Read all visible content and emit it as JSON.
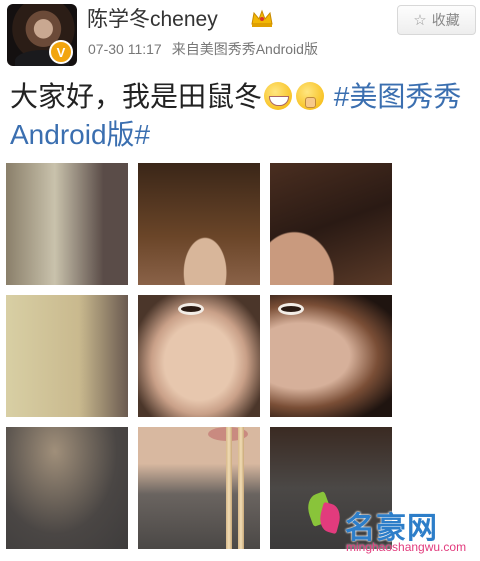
{
  "user": {
    "name": "陈学冬cheney",
    "verified_label": "V",
    "crown_icon": "crown-icon"
  },
  "post": {
    "time": "07-30 11:17",
    "source": "来自美图秀秀Android版",
    "text_main": "大家好，我是田鼠冬",
    "emojis": [
      "grin-emoji",
      "shush-emoji"
    ],
    "hashtag_part1": "#美图秀",
    "hashtag_part2": "秀Android版#"
  },
  "favorite_button": {
    "label": "收藏",
    "icon": "star-icon"
  },
  "photo_grid": {
    "rows": 3,
    "cols": 3
  },
  "watermark": {
    "brand": "名豪网",
    "url": "minghaoshangwu.com"
  },
  "colors": {
    "hashtag": "#3b6fb0",
    "badge": "#f2a50f",
    "watermark_blue": "#2d7ec9",
    "watermark_pink": "#e23b7d"
  }
}
